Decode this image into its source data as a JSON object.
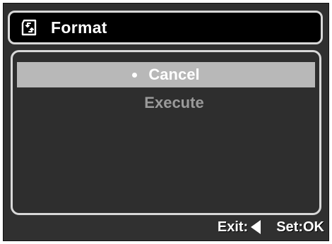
{
  "header": {
    "title": "Format",
    "icon": "format-card-icon"
  },
  "menu": {
    "items": [
      {
        "label": "Cancel",
        "selected": true
      },
      {
        "label": "Execute",
        "selected": false
      }
    ]
  },
  "footer": {
    "exit_label": "Exit:",
    "exit_icon": "left-arrow-icon",
    "set_label": "Set:OK"
  },
  "colors": {
    "background": "#303030",
    "title_bg": "#000000",
    "border": "#d8d8d8",
    "highlight": "#b8b8b8",
    "text": "#ffffff",
    "disabled_text": "#9a9a9a"
  }
}
